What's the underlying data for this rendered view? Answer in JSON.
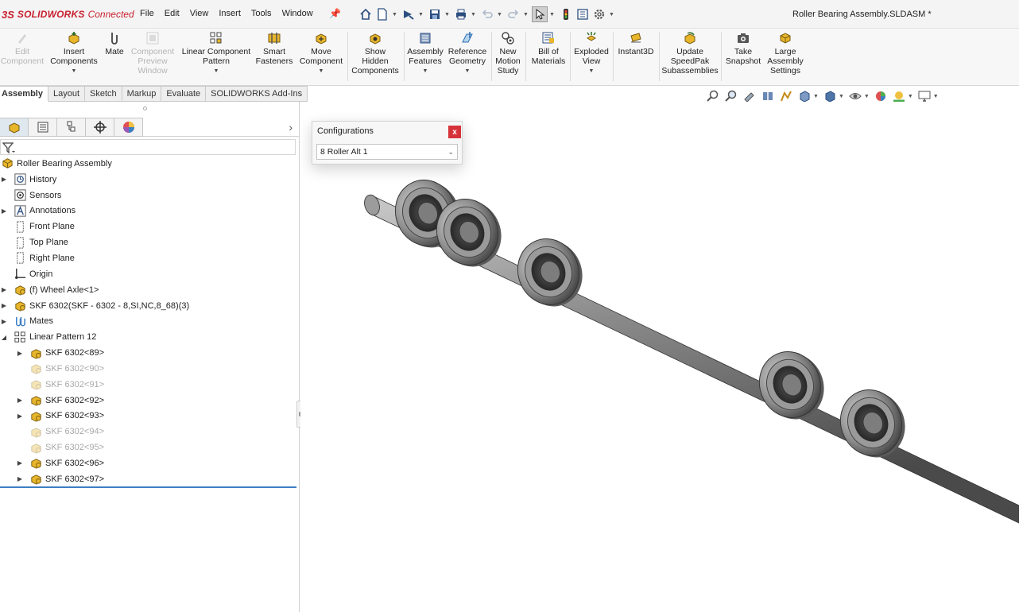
{
  "app": {
    "brand_ds": "3S",
    "brand_name": "SOLIDWORKS",
    "brand_suffix": "Connected",
    "document_title": "Roller Bearing Assembly.SLDASM *",
    "brand_color": "#c8202f"
  },
  "menu": [
    "File",
    "Edit",
    "View",
    "Insert",
    "Tools",
    "Window"
  ],
  "quick_access_icons": [
    "home-icon",
    "new-document-icon",
    "open-icon",
    "save-icon",
    "print-icon",
    "undo-icon",
    "redo-icon",
    "select-icon",
    "rebuild-icon",
    "file-properties-icon",
    "options-icon"
  ],
  "ribbon": {
    "edit_component": "Edit\nComponent",
    "insert_components": "Insert\nComponents",
    "mate": "Mate",
    "component_preview": "Component\nPreview\nWindow",
    "linear_pattern": "Linear Component\nPattern",
    "smart_fasteners": "Smart\nFasteners",
    "move_component": "Move\nComponent",
    "show_hidden": "Show\nHidden\nComponents",
    "assembly_features": "Assembly\nFeatures",
    "reference_geometry": "Reference\nGeometry",
    "new_motion_study": "New\nMotion\nStudy",
    "bill_of_materials": "Bill of\nMaterials",
    "exploded_view": "Exploded\nView",
    "instant3d": "Instant3D",
    "update_speedpak": "Update\nSpeedPak\nSubassemblies",
    "take_snapshot": "Take\nSnapshot",
    "large_assembly": "Large\nAssembly\nSettings"
  },
  "tabs": [
    "Assembly",
    "Layout",
    "Sketch",
    "Markup",
    "Evaluate",
    "SOLIDWORKS Add-Ins"
  ],
  "feature_tree": {
    "root": "Roller Bearing Assembly",
    "items": [
      {
        "label": "History",
        "icon": "history-icon",
        "expandable": true,
        "suppressed": false,
        "indent": 0
      },
      {
        "label": "Sensors",
        "icon": "sensors-icon",
        "expandable": false,
        "suppressed": false,
        "indent": 0
      },
      {
        "label": "Annotations",
        "icon": "annotations-icon",
        "expandable": true,
        "suppressed": false,
        "indent": 0
      },
      {
        "label": "Front Plane",
        "icon": "plane-icon",
        "expandable": false,
        "suppressed": false,
        "indent": 0
      },
      {
        "label": "Top Plane",
        "icon": "plane-icon",
        "expandable": false,
        "suppressed": false,
        "indent": 0
      },
      {
        "label": "Right Plane",
        "icon": "plane-icon",
        "expandable": false,
        "suppressed": false,
        "indent": 0
      },
      {
        "label": "Origin",
        "icon": "origin-icon",
        "expandable": false,
        "suppressed": false,
        "indent": 0
      },
      {
        "label": "(f) Wheel Axle<1>",
        "icon": "part-icon",
        "expandable": true,
        "suppressed": false,
        "indent": 0
      },
      {
        "label": "SKF 6302(SKF - 6302 - 8,SI,NC,8_68)(3)",
        "icon": "part-icon",
        "expandable": true,
        "suppressed": false,
        "indent": 0
      },
      {
        "label": "Mates",
        "icon": "mates-icon",
        "expandable": true,
        "suppressed": false,
        "indent": 0
      },
      {
        "label": "Linear Pattern 12",
        "icon": "linear-pattern-icon",
        "expandable": true,
        "expanded": true,
        "suppressed": false,
        "indent": 0
      },
      {
        "label": "SKF 6302<89>",
        "icon": "part-icon",
        "expandable": true,
        "suppressed": false,
        "indent": 1
      },
      {
        "label": "SKF 6302<90>",
        "icon": "part-icon",
        "expandable": false,
        "suppressed": true,
        "indent": 1
      },
      {
        "label": "SKF 6302<91>",
        "icon": "part-icon",
        "expandable": false,
        "suppressed": true,
        "indent": 1
      },
      {
        "label": "SKF 6302<92>",
        "icon": "part-icon",
        "expandable": true,
        "suppressed": false,
        "indent": 1
      },
      {
        "label": "SKF 6302<93>",
        "icon": "part-icon",
        "expandable": true,
        "suppressed": false,
        "indent": 1
      },
      {
        "label": "SKF 6302<94>",
        "icon": "part-icon",
        "expandable": false,
        "suppressed": true,
        "indent": 1
      },
      {
        "label": "SKF 6302<95>",
        "icon": "part-icon",
        "expandable": false,
        "suppressed": true,
        "indent": 1
      },
      {
        "label": "SKF 6302<96>",
        "icon": "part-icon",
        "expandable": true,
        "suppressed": false,
        "indent": 1
      },
      {
        "label": "SKF 6302<97>",
        "icon": "part-icon",
        "expandable": true,
        "suppressed": false,
        "indent": 1
      }
    ]
  },
  "configurations": {
    "title": "Configurations",
    "close": "x",
    "selected": "8 Roller Alt 1"
  },
  "colors": {
    "accent": "#3d7fc4",
    "close": "#d6323a",
    "part_yellow": "#e8b62b"
  }
}
